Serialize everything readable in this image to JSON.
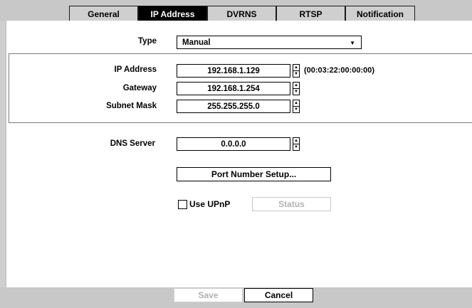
{
  "tabs": [
    {
      "label": "General"
    },
    {
      "label": "IP Address"
    },
    {
      "label": "DVRNS"
    },
    {
      "label": "RTSP"
    },
    {
      "label": "Notification"
    }
  ],
  "form": {
    "type_label": "Type",
    "type_value": "Manual",
    "ip_label": "IP Address",
    "ip_value": "192.168.1.129",
    "mac": "(00:03:22:00:00:00)",
    "gateway_label": "Gateway",
    "gateway_value": "192.168.1.254",
    "subnet_label": "Subnet Mask",
    "subnet_value": "255.255.255.0",
    "dns_label": "DNS Server",
    "dns_value": "0.0.0.0",
    "port_button": "Port Number Setup...",
    "upnp_label": "Use UPnP",
    "status_button": "Status"
  },
  "footer": {
    "save": "Save",
    "cancel": "Cancel"
  }
}
